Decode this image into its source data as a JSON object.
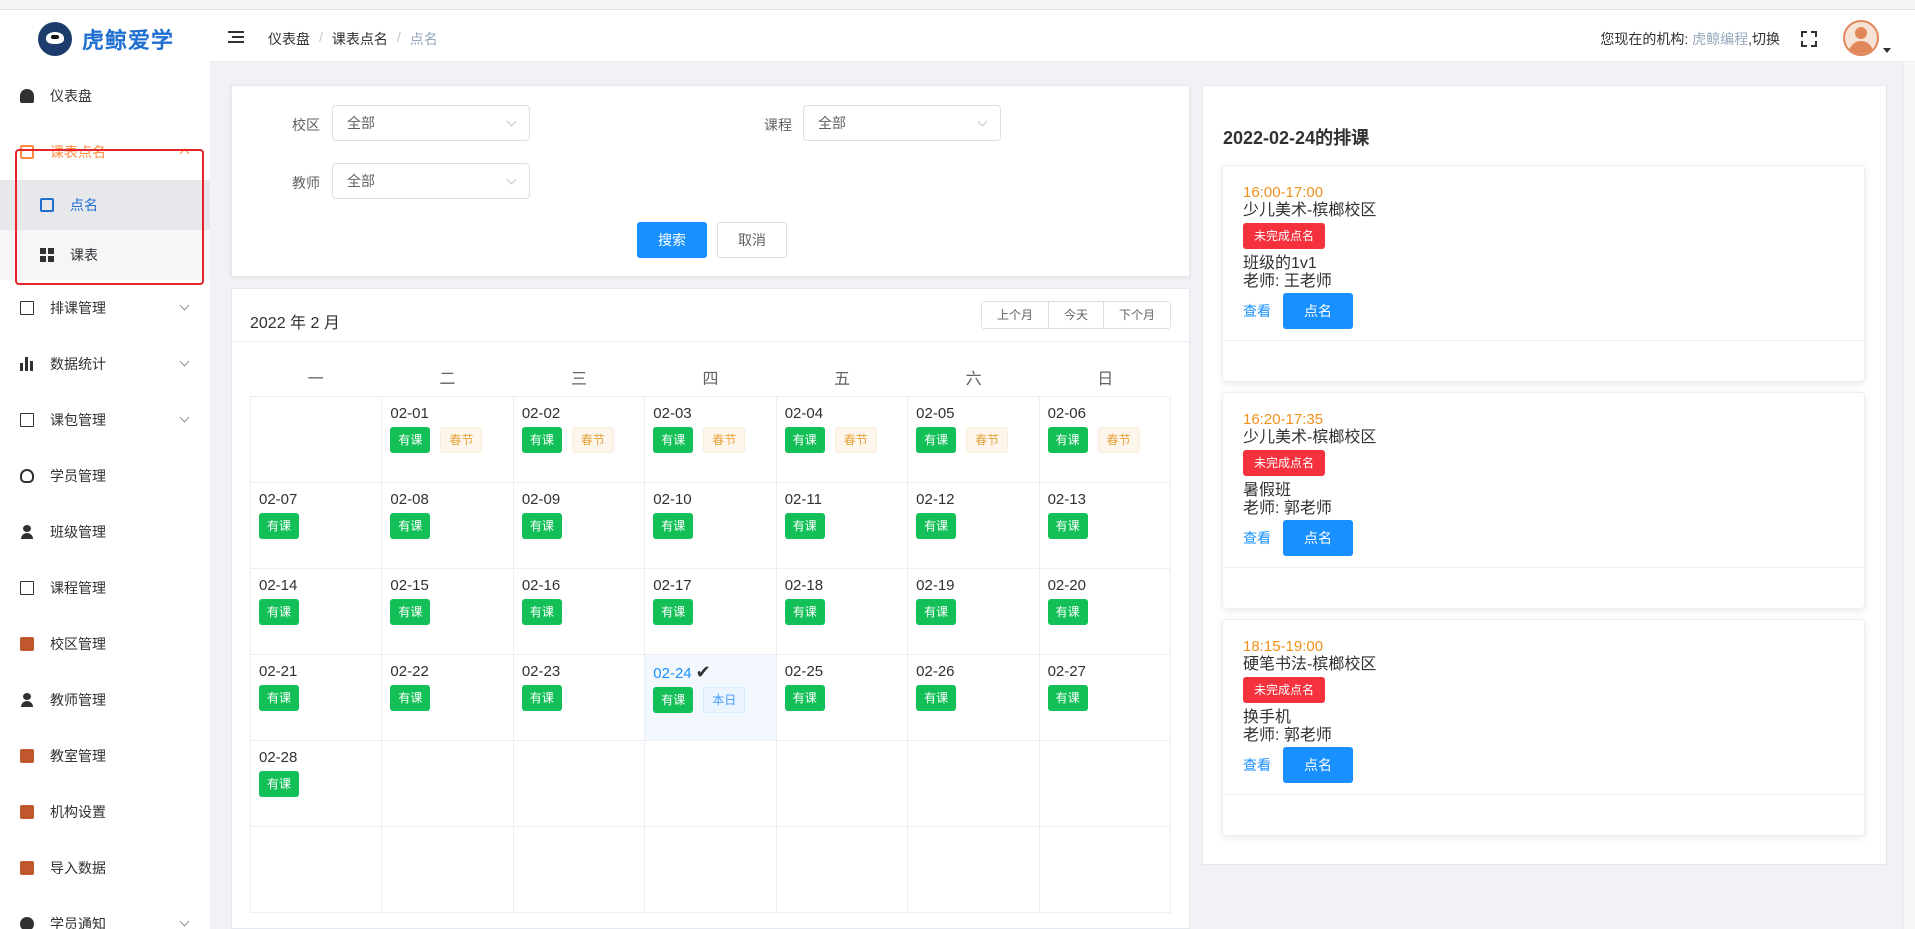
{
  "sidebar": {
    "logo_text": "虎鲸爱学",
    "items": [
      {
        "label": "仪表盘"
      },
      {
        "label": "课表点名"
      },
      {
        "label": "点名"
      },
      {
        "label": "课表"
      },
      {
        "label": "排课管理"
      },
      {
        "label": "数据统计"
      },
      {
        "label": "课包管理"
      },
      {
        "label": "学员管理"
      },
      {
        "label": "班级管理"
      },
      {
        "label": "课程管理"
      },
      {
        "label": "校区管理"
      },
      {
        "label": "教师管理"
      },
      {
        "label": "教室管理"
      },
      {
        "label": "机构设置"
      },
      {
        "label": "导入数据"
      },
      {
        "label": "学员通知"
      }
    ]
  },
  "header": {
    "breadcrumb": [
      "仪表盘",
      "课表点名",
      "点名"
    ],
    "org_prefix": "您现在的机构: ",
    "org_name": "虎鲸编程",
    "org_switch": ",切换"
  },
  "filters": {
    "campus_label": "校区",
    "campus_value": "全部",
    "course_label": "课程",
    "course_value": "全部",
    "teacher_label": "教师",
    "teacher_value": "全部",
    "search_label": "搜索",
    "cancel_label": "取消"
  },
  "calendar": {
    "title": "2022 年 2 月",
    "prev_label": "上个月",
    "today_label": "今天",
    "next_label": "下个月",
    "weekdays": [
      "一",
      "二",
      "三",
      "四",
      "五",
      "六",
      "日"
    ],
    "has_class_label": "有课",
    "holiday_label": "春节",
    "today_tag_label": "本日",
    "check_mark": "✔"
  },
  "schedule": {
    "title": "2022-02-24的排课",
    "status_label": "未完成点名",
    "view_label": "查看",
    "callroll_label": "点名",
    "items": [
      {
        "time": "16:00-17:00",
        "course": "少儿美术-槟榔校区",
        "class_name": "班级的1v1",
        "teacher": "老师: 王老师"
      },
      {
        "time": "16:20-17:35",
        "course": "少儿美术-槟榔校区",
        "class_name": "暑假班",
        "teacher": "老师: 郭老师"
      },
      {
        "time": "18:15-19:00",
        "course": "硬笔书法-槟榔校区",
        "class_name": "换手机",
        "teacher": "老师: 郭老师"
      }
    ]
  },
  "colors": {
    "primary": "#1890ff",
    "accent_orange": "#ff8a3d",
    "tag_green": "#13c058",
    "status_red": "#f5313d",
    "highlight_red": "#e4242b"
  }
}
